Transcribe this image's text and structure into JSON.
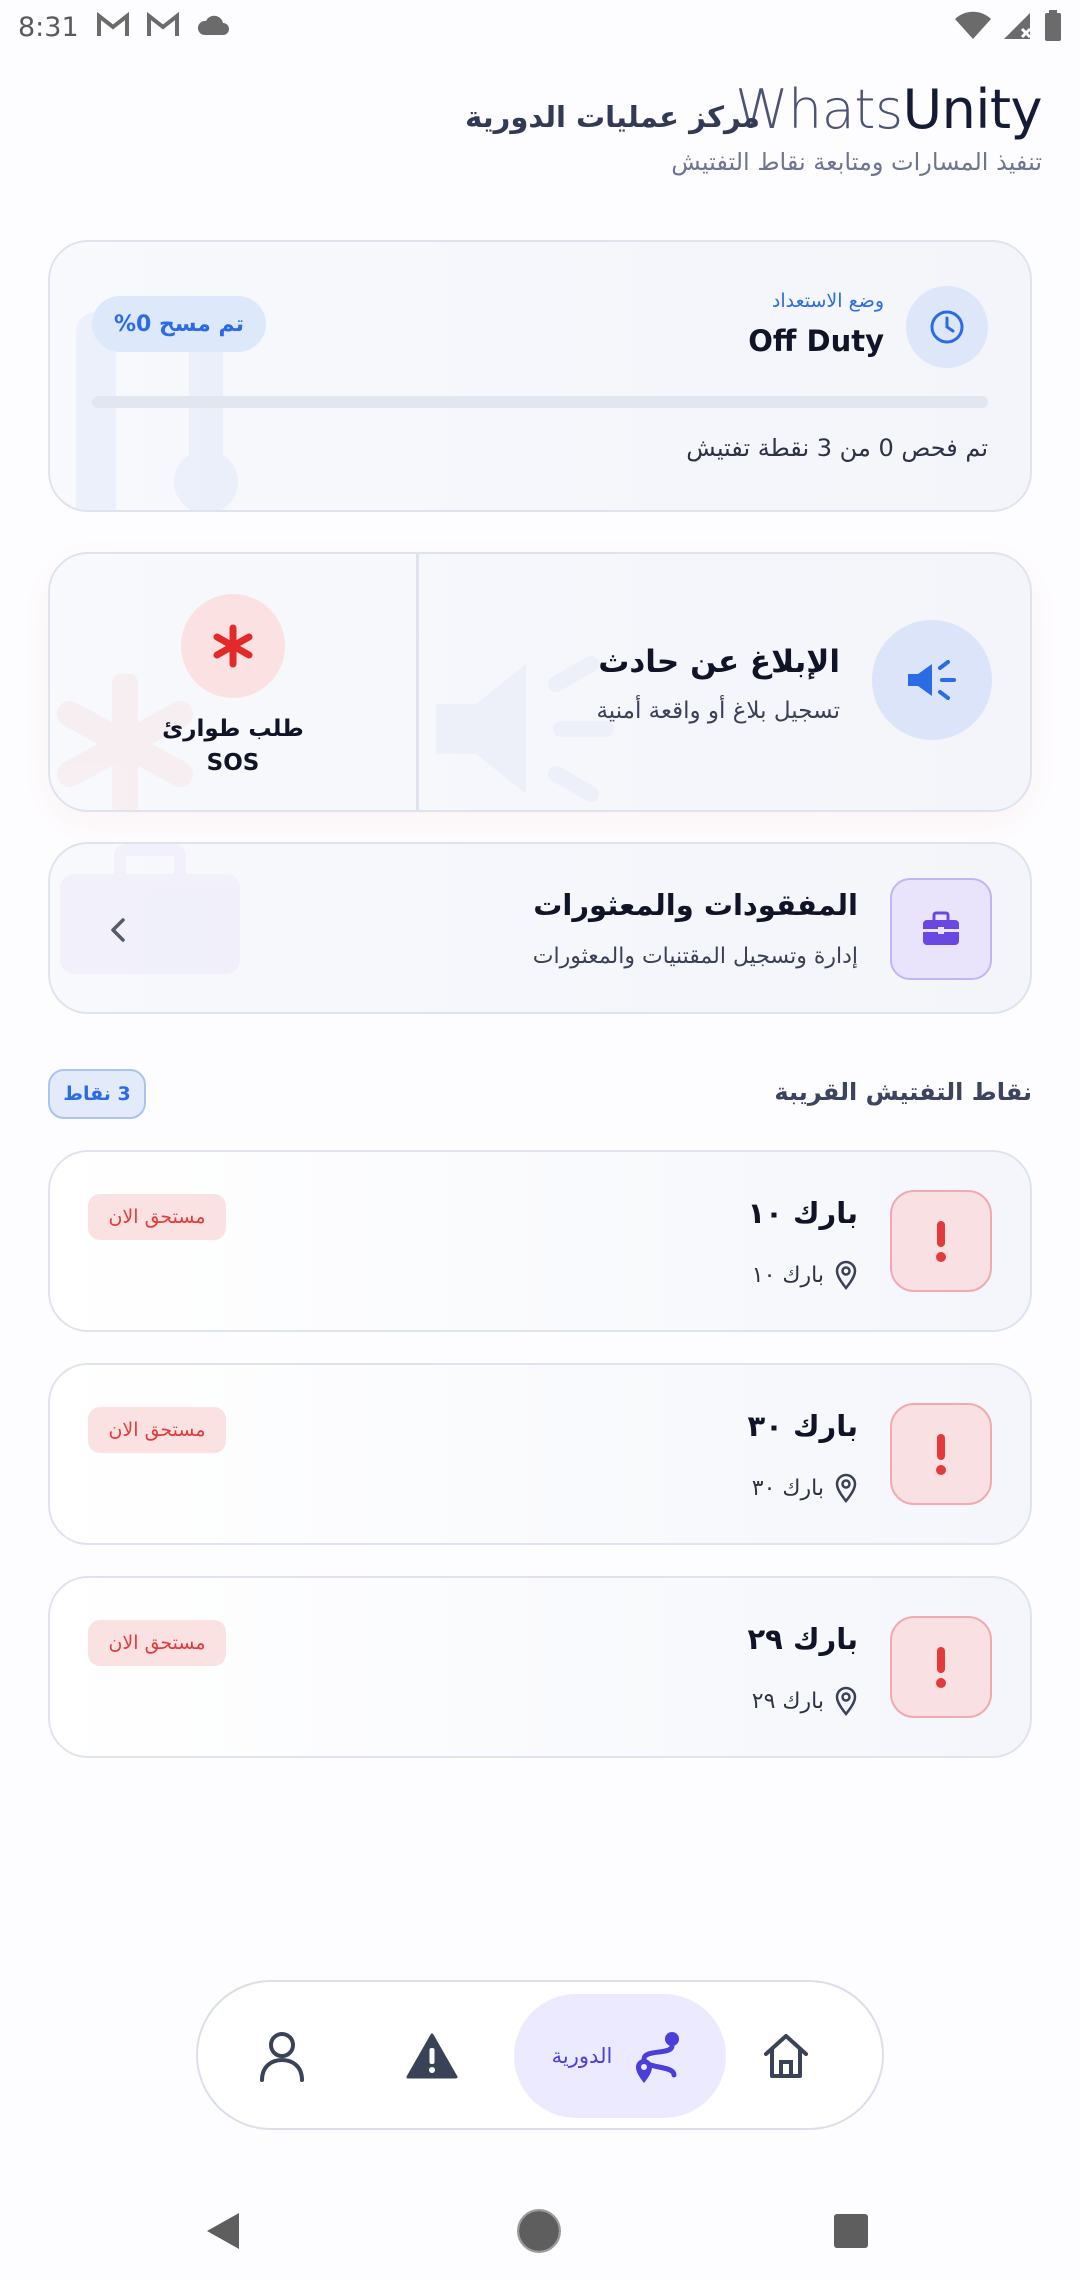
{
  "status_bar": {
    "time": "8:31"
  },
  "header": {
    "brand_part1": "Whats",
    "brand_part2": "Unity",
    "title": "مركز عمليات الدورية",
    "subtitle": "تنفيذ المسارات ومتابعة نقاط التفتيش"
  },
  "readiness": {
    "label": "وضع الاستعداد",
    "status": "Off Duty",
    "scan_badge": "تم مسح 0%",
    "progress_fraction": 0,
    "count_text": "تم فحص 0 من 3 نقطة تفتيش"
  },
  "report": {
    "title": "الإبلاغ عن حادث",
    "subtitle": "تسجيل بلاغ أو واقعة أمنية"
  },
  "sos": {
    "line1": "طلب طوارئ",
    "line2": "SOS"
  },
  "lost_found": {
    "title": "المفقودات والمعثورات",
    "subtitle": "إدارة وتسجيل المقتنيات والمعثورات"
  },
  "checkpoints_section": {
    "title": "نقاط التفتيش القريبة",
    "count_badge": "3 نقاط"
  },
  "checkpoints": [
    {
      "title": "بارك ١٠",
      "location": "بارك ١٠",
      "badge": "مستحق الان"
    },
    {
      "title": "بارك ٣٠",
      "location": "بارك ٣٠",
      "badge": "مستحق الان"
    },
    {
      "title": "بارك ٢٩",
      "location": "بارك ٢٩",
      "badge": "مستحق الان"
    }
  ],
  "bottom_nav": {
    "active_label": "الدورية",
    "items": [
      "home-icon",
      "route-icon",
      "warning-icon",
      "user-icon"
    ]
  },
  "colors": {
    "accent": "#2c6be6",
    "patrol_accent": "#4a3fd9",
    "danger": "#e33b3b"
  }
}
